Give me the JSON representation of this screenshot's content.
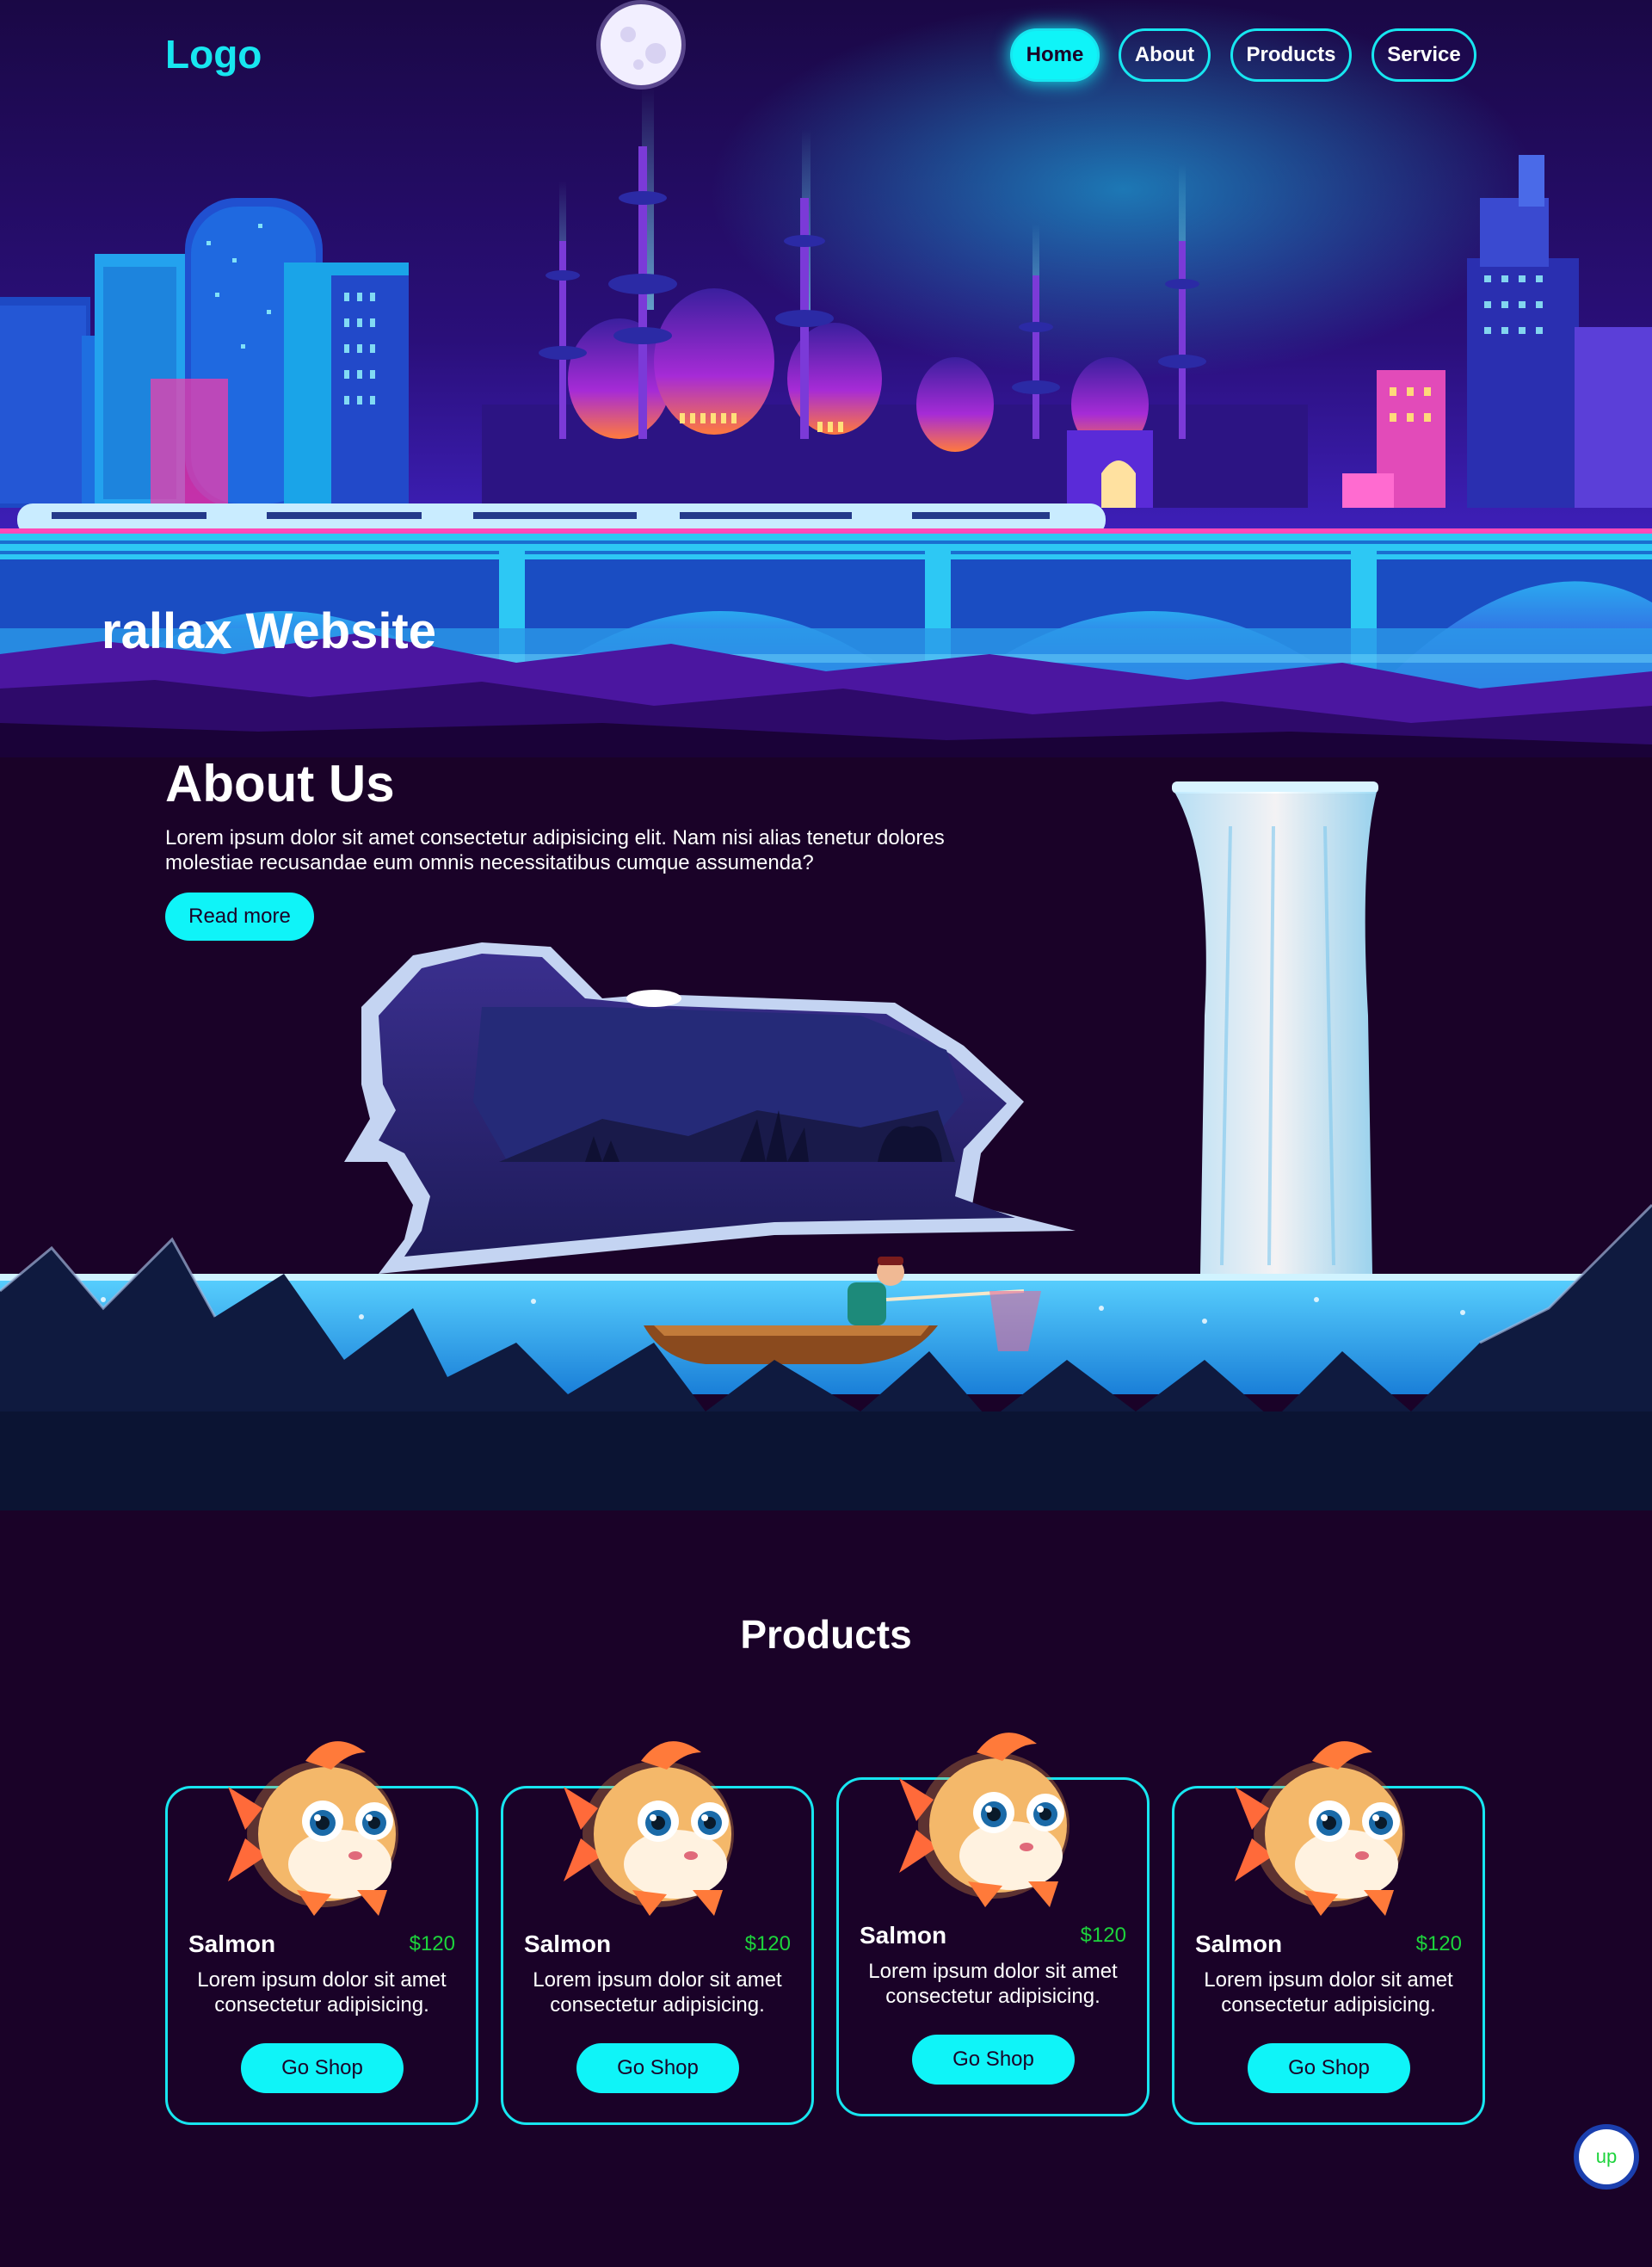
{
  "header": {
    "logo": "Logo",
    "nav": [
      {
        "label": "Home",
        "active": true
      },
      {
        "label": "About",
        "active": false
      },
      {
        "label": "Products",
        "active": false
      },
      {
        "label": "Service",
        "active": false
      }
    ]
  },
  "hero": {
    "title_visible": "rallax Website"
  },
  "about": {
    "title": "About Us",
    "text": "Lorem ipsum dolor sit amet consectetur adipisicing elit. Nam nisi alias tenetur dolores molestiae recusandae eum omnis necessitatibus cumque assumenda?",
    "button": "Read more"
  },
  "products": {
    "title": "Products",
    "items": [
      {
        "name": "Salmon",
        "price": "$120",
        "desc": "Lorem ipsum dolor sit amet consectetur adipisicing.",
        "button": "Go Shop"
      },
      {
        "name": "Salmon",
        "price": "$120",
        "desc": "Lorem ipsum dolor sit amet consectetur adipisicing.",
        "button": "Go Shop"
      },
      {
        "name": "Salmon",
        "price": "$120",
        "desc": "Lorem ipsum dolor sit amet consectetur adipisicing.",
        "button": "Go Shop"
      },
      {
        "name": "Salmon",
        "price": "$120",
        "desc": "Lorem ipsum dolor sit amet consectetur adipisicing.",
        "button": "Go Shop"
      }
    ]
  },
  "scroll_top": {
    "label": "up"
  },
  "colors": {
    "accent": "#0ff4f8",
    "price": "#1dd33c",
    "background": "#1a0228"
  }
}
